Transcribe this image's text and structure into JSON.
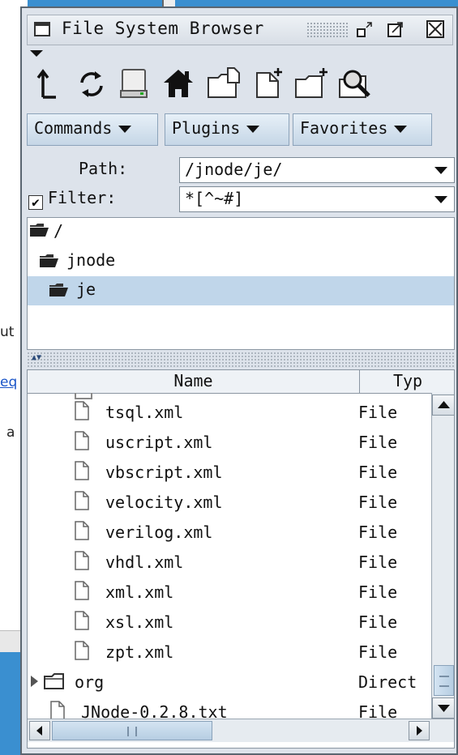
{
  "background_window": {
    "fragments": [
      "ut",
      "eq",
      "a"
    ]
  },
  "window": {
    "title": "File System Browser"
  },
  "toolbar": {
    "icons": [
      "up-directory-icon",
      "reload-icon",
      "drive-icon",
      "home-icon",
      "new-folder-icon",
      "new-file-icon",
      "new-directory-icon",
      "search-icon"
    ]
  },
  "menus": {
    "commands": "Commands",
    "plugins": "Plugins",
    "favorites": "Favorites"
  },
  "path": {
    "label": "Path:",
    "value": "/jnode/je/"
  },
  "filter": {
    "label": "Filter:",
    "checked": true,
    "check_glyph": "✔",
    "value": "*[^~#]"
  },
  "tree": {
    "items": [
      {
        "label": "/",
        "selected": false
      },
      {
        "label": "jnode",
        "selected": false
      },
      {
        "label": "je",
        "selected": true
      }
    ]
  },
  "table": {
    "columns": [
      "Name",
      "Typ"
    ],
    "rows": [
      {
        "name": "tsql.xml",
        "type": "File",
        "kind": "file"
      },
      {
        "name": "uscript.xml",
        "type": "File",
        "kind": "file"
      },
      {
        "name": "vbscript.xml",
        "type": "File",
        "kind": "file"
      },
      {
        "name": "velocity.xml",
        "type": "File",
        "kind": "file"
      },
      {
        "name": "verilog.xml",
        "type": "File",
        "kind": "file"
      },
      {
        "name": "vhdl.xml",
        "type": "File",
        "kind": "file"
      },
      {
        "name": "xml.xml",
        "type": "File",
        "kind": "file"
      },
      {
        "name": "xsl.xml",
        "type": "File",
        "kind": "file"
      },
      {
        "name": "zpt.xml",
        "type": "File",
        "kind": "file"
      },
      {
        "name": "org",
        "type": "Direct",
        "kind": "folder"
      },
      {
        "name": "JNode-0.2.8.txt",
        "type": "File",
        "kind": "file"
      }
    ]
  },
  "colors": {
    "selection": "#c0d6ea",
    "desktop": "#3a8fd0"
  }
}
